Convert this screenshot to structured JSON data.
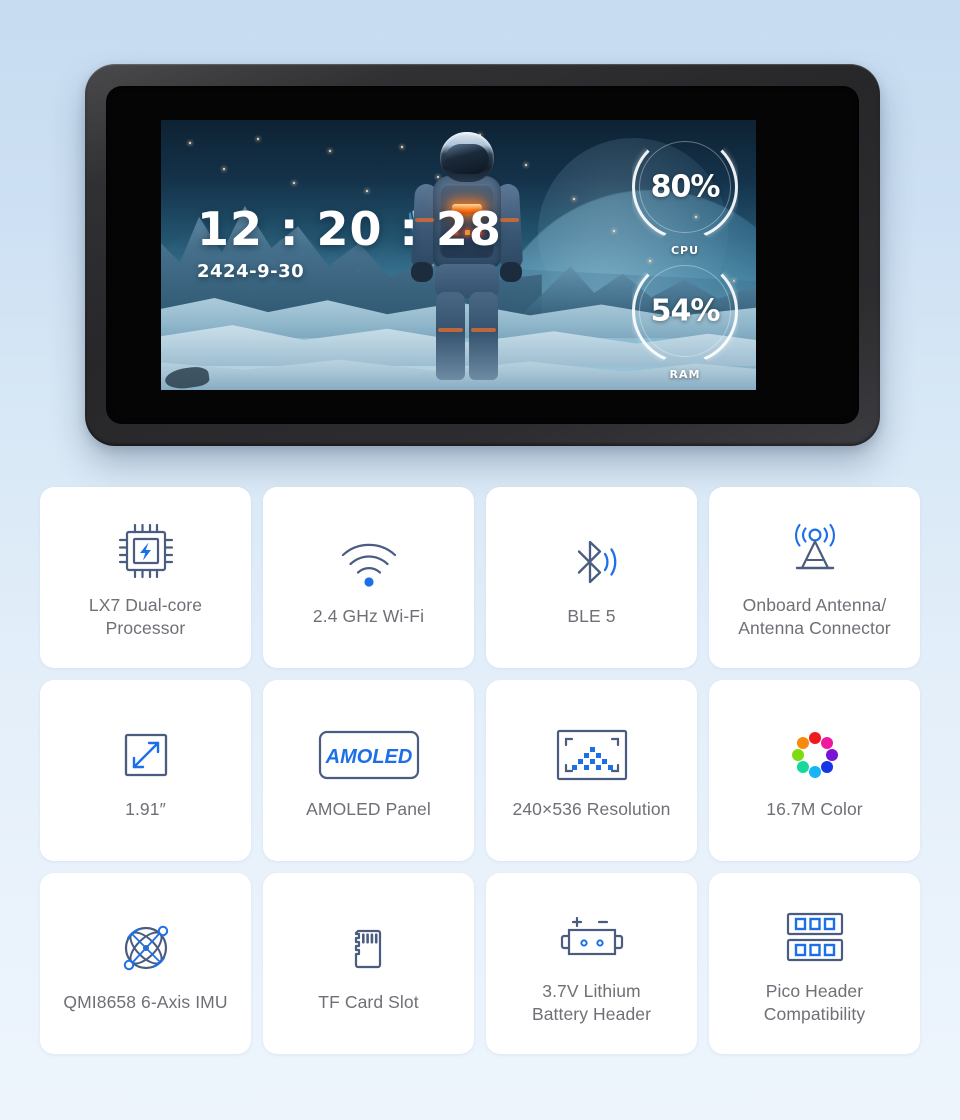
{
  "colors": {
    "background_top": "#c7dcf1",
    "background_bottom": "#edf4fc",
    "card_bg": "#ffffff",
    "icon_navy": "#4a5d80",
    "icon_blue": "#1d6fe8",
    "label_gray": "#6e7076",
    "device_body": "#2b2b2e",
    "screen_black": "#050506"
  },
  "device": {
    "name": "amoled-display-module",
    "screen": {
      "clock": {
        "time": "12 : 20 : 28",
        "date": "2424-9-30"
      },
      "gauges": [
        {
          "name": "cpu-gauge",
          "value": "80%",
          "percent": 80,
          "label": "CPU"
        },
        {
          "name": "ram-gauge",
          "value": "54%",
          "percent": 54,
          "label": "RAM"
        }
      ],
      "wallpaper_description": "astronaut standing on icy mountain landscape with planet and atmospheric arc"
    }
  },
  "features": [
    {
      "icon": "cpu-chip-icon",
      "label": "LX7 Dual-core\nProcessor"
    },
    {
      "icon": "wifi-icon",
      "label": "2.4 GHz Wi-Fi"
    },
    {
      "icon": "bluetooth-icon",
      "label": "BLE 5"
    },
    {
      "icon": "antenna-tower-icon",
      "label": "Onboard Antenna/\nAntenna Connector"
    },
    {
      "icon": "diagonal-size-icon",
      "label": "1.91″"
    },
    {
      "icon": "amoled-panel-icon",
      "label": "AMOLED Panel",
      "badge_text": "AMOLED"
    },
    {
      "icon": "resolution-icon",
      "label": "240×536 Resolution"
    },
    {
      "icon": "color-wheel-icon",
      "label": "16.7M Color"
    },
    {
      "icon": "gyroscope-imu-icon",
      "label": "QMI8658 6-Axis IMU"
    },
    {
      "icon": "tf-card-icon",
      "label": "TF Card Slot"
    },
    {
      "icon": "battery-header-icon",
      "label": "3.7V Lithium\nBattery Header"
    },
    {
      "icon": "pico-header-icon",
      "label": "Pico Header\nCompatibility"
    }
  ],
  "color_wheel_dots": [
    "#ef1b1b",
    "#f0189e",
    "#7b11d6",
    "#1434e8",
    "#19b4f5",
    "#14d99a",
    "#7ddb12",
    "#f58a0c"
  ]
}
